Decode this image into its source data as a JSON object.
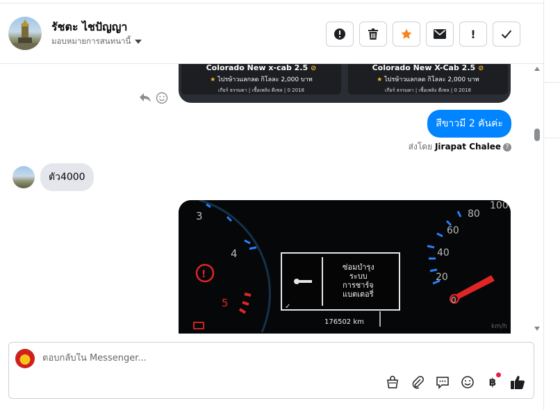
{
  "header": {
    "contact_name": "รัชตะ ไชปัญญา",
    "assign_label": "มอบหมายการสนทนานี้",
    "actions": [
      {
        "name": "spam",
        "icon": "alert-circle-icon"
      },
      {
        "name": "delete",
        "icon": "trash-icon"
      },
      {
        "name": "star",
        "icon": "star-icon",
        "color": "#f5831f"
      },
      {
        "name": "mark-unread",
        "icon": "envelope-icon"
      },
      {
        "name": "follow-up",
        "icon": "exclamation-icon",
        "label": "!"
      },
      {
        "name": "done",
        "icon": "check-icon"
      }
    ]
  },
  "messages": {
    "cards": [
      {
        "title": "Colorado New x-cab 2.5",
        "price": "ไปรษ้าวแลกลด กิโลละ 2,000 บาท",
        "meta": "เกียร์ ธรรมดา  |  เชื้อเพลิง ดีเซล  |  0 2018"
      },
      {
        "title": "Colorado New X-Cab 2.5",
        "price": "ไปรษ้าวแลกลด กิโลละ 2,000 บาท",
        "meta": "เกียร์ ธรรมดา  |  เชื้อเพลิง ดีเซล  |  0 2018"
      }
    ],
    "outgoing_text": "สีขาวมี 2 คันค่ะ",
    "sent_by_prefix": "ส่งโดย",
    "sent_by_name": "Jirapat Chalee",
    "incoming_text": "ตัว4000",
    "dashboard_photo": {
      "warning_line1": "ซ่อมบำรุง",
      "warning_line2": "ระบบ",
      "warning_line3": "การชาร์จ",
      "warning_line4": "แบตเตอรี่",
      "odometer": "176502 km",
      "left_gauge_labels": [
        "3",
        "4",
        "5"
      ],
      "right_gauge_labels": [
        "100",
        "80",
        "60",
        "40",
        "20",
        "0"
      ],
      "speed_unit": "km/h"
    }
  },
  "composer": {
    "placeholder": "ตอบกลับใน Messenger...",
    "tools": [
      "shop-bag-icon",
      "paperclip-icon",
      "saved-reply-icon",
      "emoji-icon",
      "baht-icon",
      "thumbs-up-icon"
    ],
    "baht_symbol": "฿",
    "notification_color": "#e41e3f"
  },
  "colors": {
    "accent": "#0084ff",
    "incoming_bubble": "#e4e6eb"
  }
}
